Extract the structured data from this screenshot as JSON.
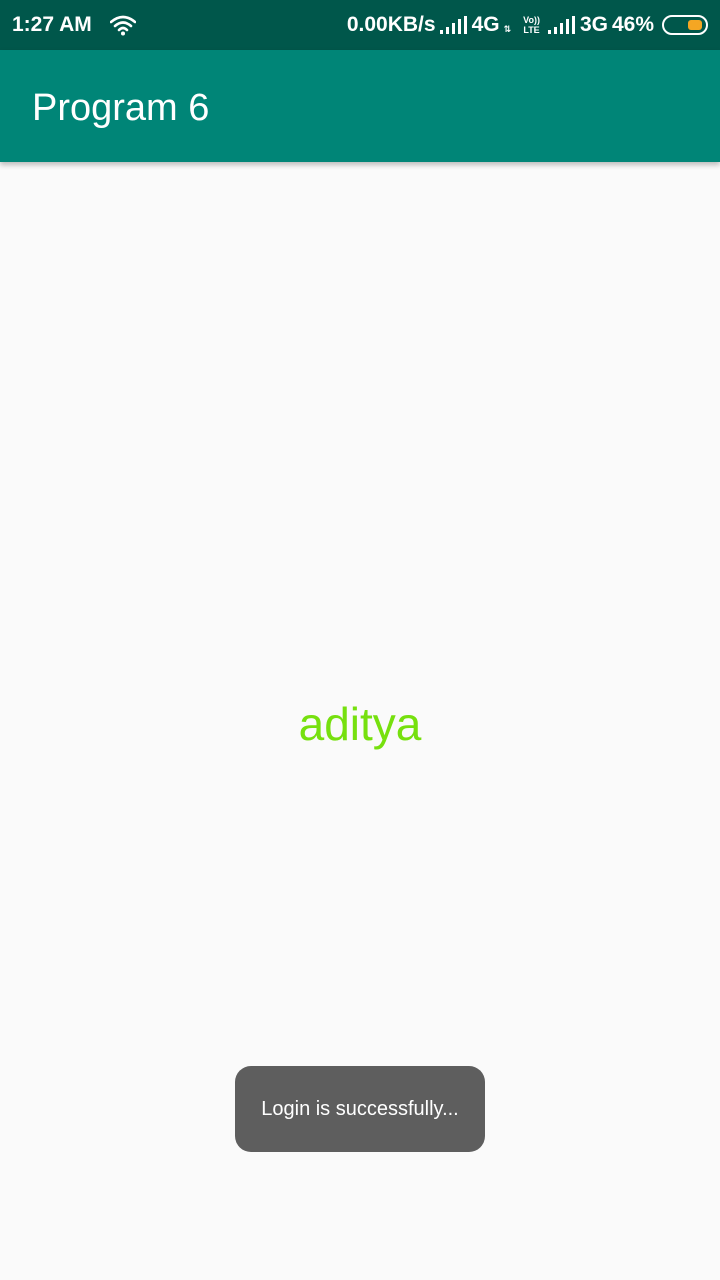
{
  "status_bar": {
    "time": "1:27 AM",
    "net_speed": "0.00KB/s",
    "network1": "4G",
    "volte_top": "Vo))",
    "volte_bottom": "LTE",
    "network2": "3G",
    "battery": "46%",
    "battery_level": 0.46,
    "battery_color": "#f5a623"
  },
  "app_bar": {
    "title": "Program 6",
    "color": "#008577"
  },
  "main": {
    "username": "aditya",
    "username_color": "#76e00e"
  },
  "toast": {
    "message": "Login is successfully..."
  }
}
